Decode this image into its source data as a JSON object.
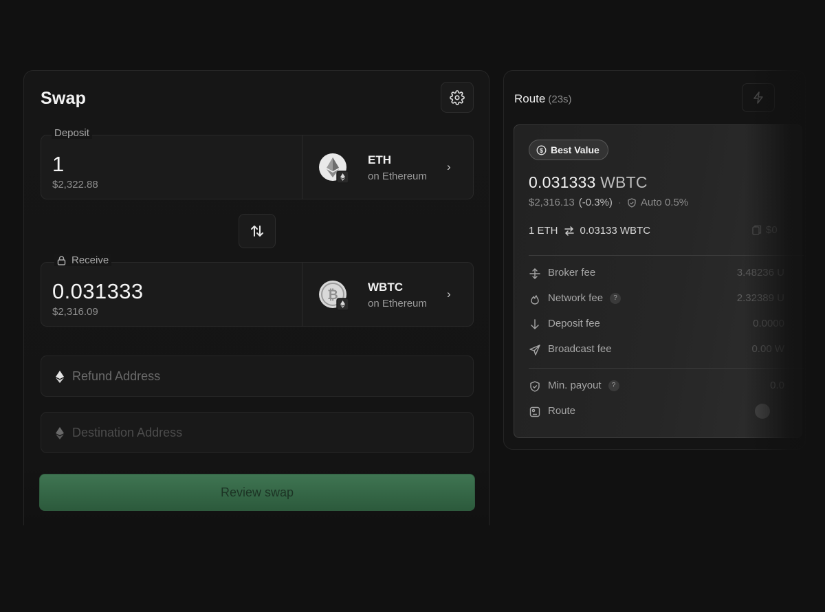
{
  "swap": {
    "title": "Swap",
    "deposit": {
      "label": "Deposit",
      "amount": "1",
      "usd": "$2,322.88",
      "token": "ETH",
      "chain": "on Ethereum",
      "token_icon": "ethereum-icon"
    },
    "receive": {
      "label": "Receive",
      "amount": "0.031333",
      "usd": "$2,316.09",
      "token": "WBTC",
      "chain": "on Ethereum",
      "token_icon": "bitcoin-icon"
    },
    "refund_placeholder": "Refund Address",
    "destination_placeholder": "Destination Address",
    "review_label": "Review swap",
    "accent_color": "#3f7552"
  },
  "route": {
    "title": "Route",
    "timer": "(23s)",
    "badge": "Best Value",
    "quote_amount": "0.031333",
    "quote_unit": "WBTC",
    "quote_usd": "$2,316.13",
    "quote_pct": "(-0.3%)",
    "slippage": "Auto 0.5%",
    "rate_from": "1 ETH",
    "rate_to": "0.03133 WBTC",
    "rate_copy_partial": "$0",
    "fees": [
      {
        "label": "Broker fee",
        "value": "3.48236 U",
        "icon": "broker-icon"
      },
      {
        "label": "Network fee",
        "value": "2.32389 U",
        "icon": "flame-icon",
        "help": "?"
      },
      {
        "label": "Deposit fee",
        "value": "0.0000",
        "icon": "arrow-down-icon"
      },
      {
        "label": "Broadcast fee",
        "value": "0.00 W",
        "icon": "send-icon"
      }
    ],
    "min_payout": {
      "label": "Min. payout",
      "value": "0.0",
      "help": "?"
    },
    "route_row": {
      "label": "Route"
    }
  }
}
